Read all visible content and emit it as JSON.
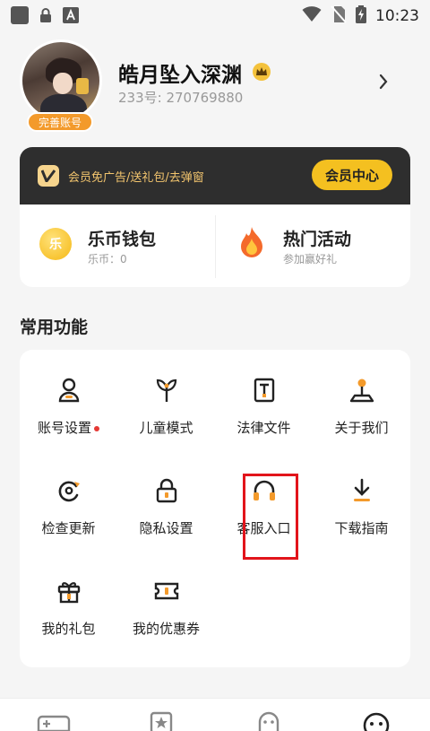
{
  "status_bar": {
    "time": "10:23",
    "icons": [
      "app-square-icon",
      "lock-icon",
      "a-icon",
      "wifi-icon",
      "no-sim-icon",
      "battery-charging-icon"
    ]
  },
  "profile": {
    "username": "皓月坠入深渊",
    "uid": "233号: 270769880",
    "complete_badge": "完善账号"
  },
  "vip": {
    "promo": "会员免广告/送礼包/去弹窗",
    "button": "会员中心",
    "colors": {
      "bar": "#2e2e2e",
      "button": "#f4c020",
      "text": "#f3c56e"
    }
  },
  "wallet": {
    "title": "乐币钱包",
    "sub": "乐币：0",
    "coin_glyph": "乐"
  },
  "activity": {
    "title": "热门活动",
    "sub": "参加赢好礼"
  },
  "section": {
    "title": "常用功能"
  },
  "functions": [
    {
      "label": "账号设置",
      "icon": "account-icon"
    },
    {
      "label": "儿童模式",
      "icon": "sprout-icon"
    },
    {
      "label": "法律文件",
      "icon": "document-icon"
    },
    {
      "label": "关于我们",
      "icon": "joystick-icon"
    },
    {
      "label": "检查更新",
      "icon": "refresh-icon"
    },
    {
      "label": "隐私设置",
      "icon": "lock-icon"
    },
    {
      "label": "客服入口",
      "icon": "headphones-icon"
    },
    {
      "label": "下载指南",
      "icon": "download-icon"
    },
    {
      "label": "我的礼包",
      "icon": "gift-icon"
    },
    {
      "label": "我的优惠券",
      "icon": "coupon-icon"
    }
  ],
  "tabbar": {
    "icons": [
      "gamepad-icon",
      "star-icon",
      "ghost-icon",
      "chat-icon"
    ]
  }
}
